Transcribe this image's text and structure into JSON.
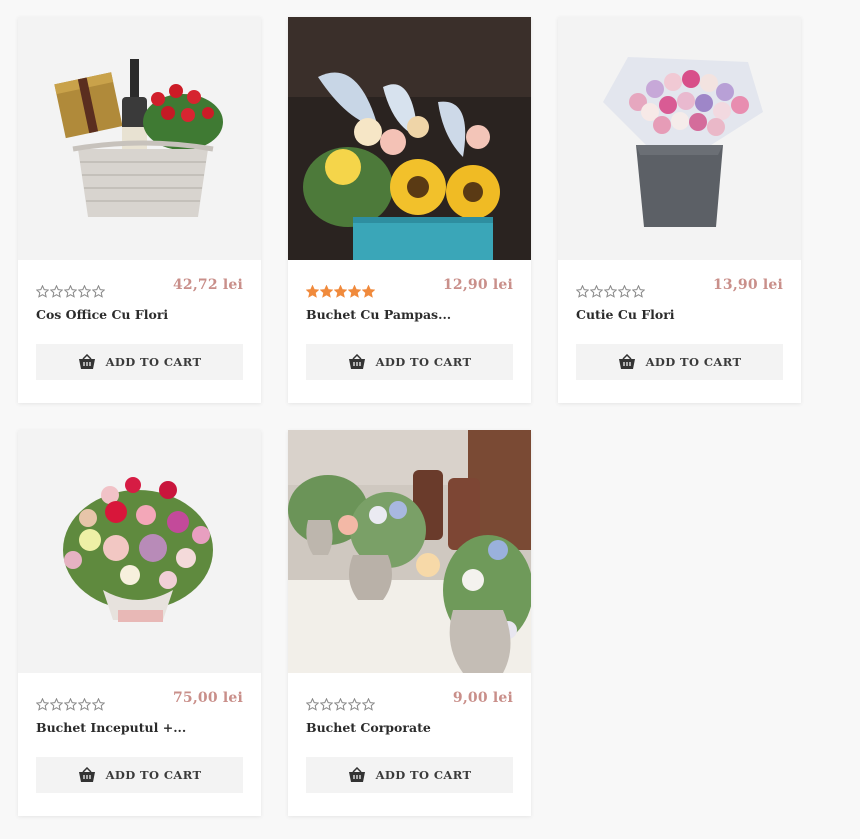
{
  "products": [
    {
      "name": "Cos Office Cu Flori",
      "price": "42,72 lei",
      "rating": 0,
      "image": "basket-wine-roses",
      "button": "ADD TO CART"
    },
    {
      "name": "Buchet Cu Pampas...",
      "price": "12,90 lei",
      "rating": 5,
      "image": "sunflower-pampas-box",
      "button": "ADD TO CART"
    },
    {
      "name": "Cutie Cu Flori",
      "price": "13,90 lei",
      "rating": 0,
      "image": "roses-in-grey-box",
      "button": "ADD TO CART"
    },
    {
      "name": "Buchet Inceputul +...",
      "price": "75,00 lei",
      "rating": 0,
      "image": "mixed-rose-arrangement",
      "button": "ADD TO CART"
    },
    {
      "name": "Buchet Corporate",
      "price": "9,00 lei",
      "rating": 0,
      "image": "table-vases-flowers",
      "button": "ADD TO CART"
    }
  ],
  "colors": {
    "price": "#c98f8a",
    "star_filled": "#f08a3c",
    "star_empty": "#888888",
    "button_bg": "#f3f3f3"
  },
  "icons": {
    "cart": "basket-icon",
    "rating": "star-icon"
  }
}
